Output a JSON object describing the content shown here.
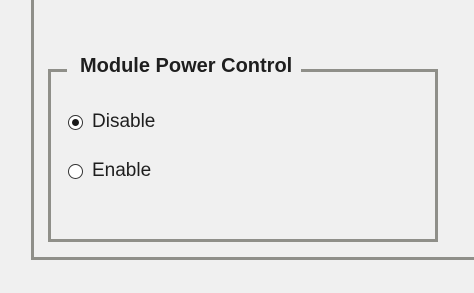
{
  "group": {
    "title": "Module Power Control"
  },
  "options": [
    {
      "label": "Disable",
      "checked": true
    },
    {
      "label": "Enable",
      "checked": false
    }
  ]
}
